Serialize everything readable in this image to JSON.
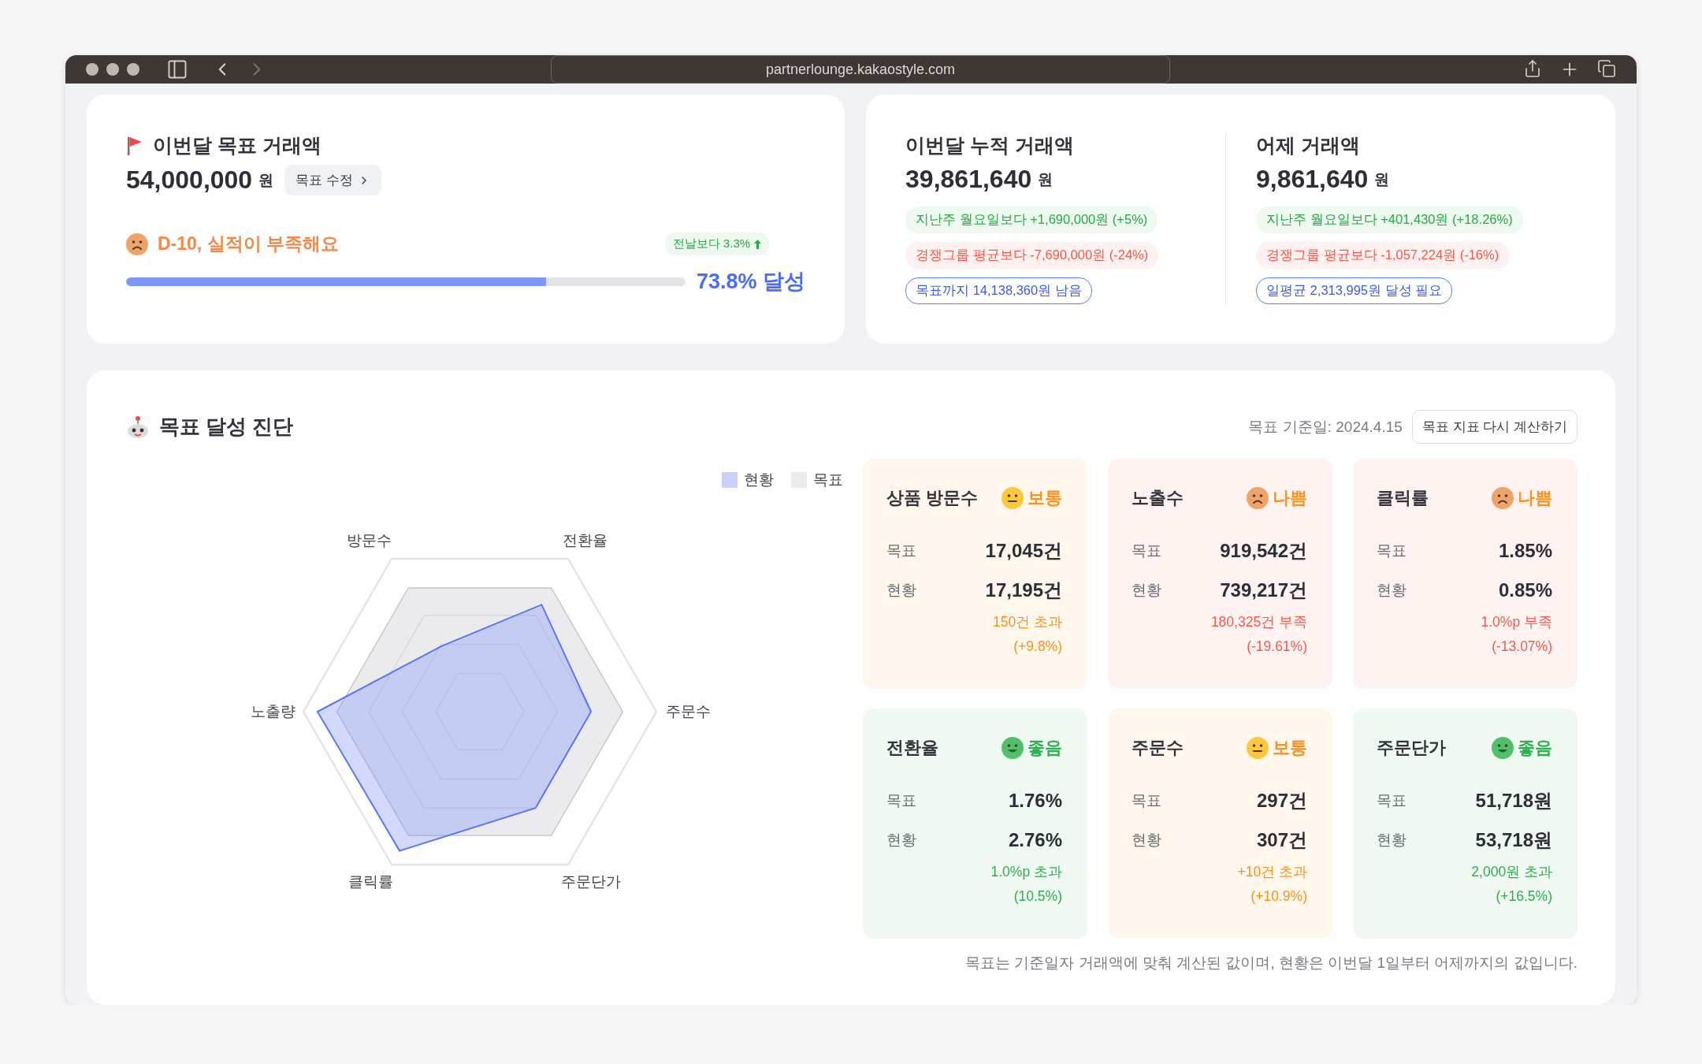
{
  "browser": {
    "url": "partnerlounge.kakaostyle.com"
  },
  "goal_card": {
    "title": "이번달 목표 거래액",
    "amount": "54,000,000",
    "unit": "원",
    "edit_button": "목표 수정",
    "status": "D-10, 실적이 부족해요",
    "change_badge": "전날보다 3.3%",
    "progress": {
      "level": 0.75,
      "reading": "73.8% 달성"
    }
  },
  "sales_card": {
    "columns": [
      {
        "title": "이번달 누적 거래액",
        "amount": "39,861,640",
        "unit": "원",
        "chips": [
          {
            "kind": "up",
            "text": "지난주 월요일보다 +1,690,000원 (+5%)"
          },
          {
            "kind": "down",
            "text": "경쟁그룹 평균보다 -7,690,000원 (-24%)"
          },
          {
            "kind": "target",
            "text": "목표까지 14,138,360원 남음"
          }
        ]
      },
      {
        "title": "어제 거래액",
        "amount": "9,861,640",
        "unit": "원",
        "chips": [
          {
            "kind": "up",
            "text": "지난주 월요일보다 +401,430원 (+18.26%)"
          },
          {
            "kind": "down",
            "text": "경쟁그룹 평균보다 -1,057,224원 (-16%)"
          },
          {
            "kind": "target",
            "text": "일평균 2,313,995원 달성 필요"
          }
        ]
      }
    ]
  },
  "diagnosis": {
    "title": "목표 달성 진단",
    "base_date": "목표 기준일: 2024.4.15",
    "recalc_button": "목표 지표 다시 계산하기",
    "legend": [
      {
        "label": "현황",
        "color": "#c9d1fb"
      },
      {
        "label": "목표",
        "color": "#ebebee"
      }
    ],
    "axes": [
      "주문수",
      "전환율",
      "방문수",
      "노출량",
      "클릭률",
      "주문단가"
    ],
    "metrics": [
      {
        "name": "상품 방문수",
        "kind": "normal",
        "status_label": "보통",
        "rows": [
          {
            "label": "목표",
            "value": "17,045건"
          },
          {
            "label": "현황",
            "value": "17,195건"
          }
        ],
        "diff": [
          "150건 초과",
          "(+9.8%)"
        ]
      },
      {
        "name": "노출수",
        "kind": "bad",
        "status_label": "나쁨",
        "rows": [
          {
            "label": "목표",
            "value": "919,542건"
          },
          {
            "label": "현황",
            "value": "739,217건"
          }
        ],
        "diff": [
          "180,325건 부족",
          "(-19.61%)"
        ]
      },
      {
        "name": "클릭률",
        "kind": "bad",
        "status_label": "나쁨",
        "rows": [
          {
            "label": "목표",
            "value": "1.85%"
          },
          {
            "label": "현황",
            "value": "0.85%"
          }
        ],
        "diff": [
          "1.0%p 부족",
          "(-13.07%)"
        ]
      },
      {
        "name": "전환율",
        "kind": "good",
        "status_label": "좋음",
        "rows": [
          {
            "label": "목표",
            "value": "1.76%"
          },
          {
            "label": "현황",
            "value": "2.76%"
          }
        ],
        "diff": [
          "1.0%p 초과",
          "(10.5%)"
        ]
      },
      {
        "name": "주문수",
        "kind": "normal",
        "status_label": "보통",
        "rows": [
          {
            "label": "목표",
            "value": "297건"
          },
          {
            "label": "현황",
            "value": "307건"
          }
        ],
        "diff": [
          "+10건 초과",
          "(+10.9%)"
        ]
      },
      {
        "name": "주문단가",
        "kind": "good",
        "status_label": "좋음",
        "rows": [
          {
            "label": "목표",
            "value": "51,718원"
          },
          {
            "label": "현황",
            "value": "53,718원"
          }
        ],
        "diff": [
          "2,000원 초과",
          "(+16.5%)"
        ]
      }
    ],
    "footnote": "목표는 기준일자 거래액에 맞춰 계산된 값이며, 현황은 이번달 1일부터 어제까지의 값입니다."
  }
}
